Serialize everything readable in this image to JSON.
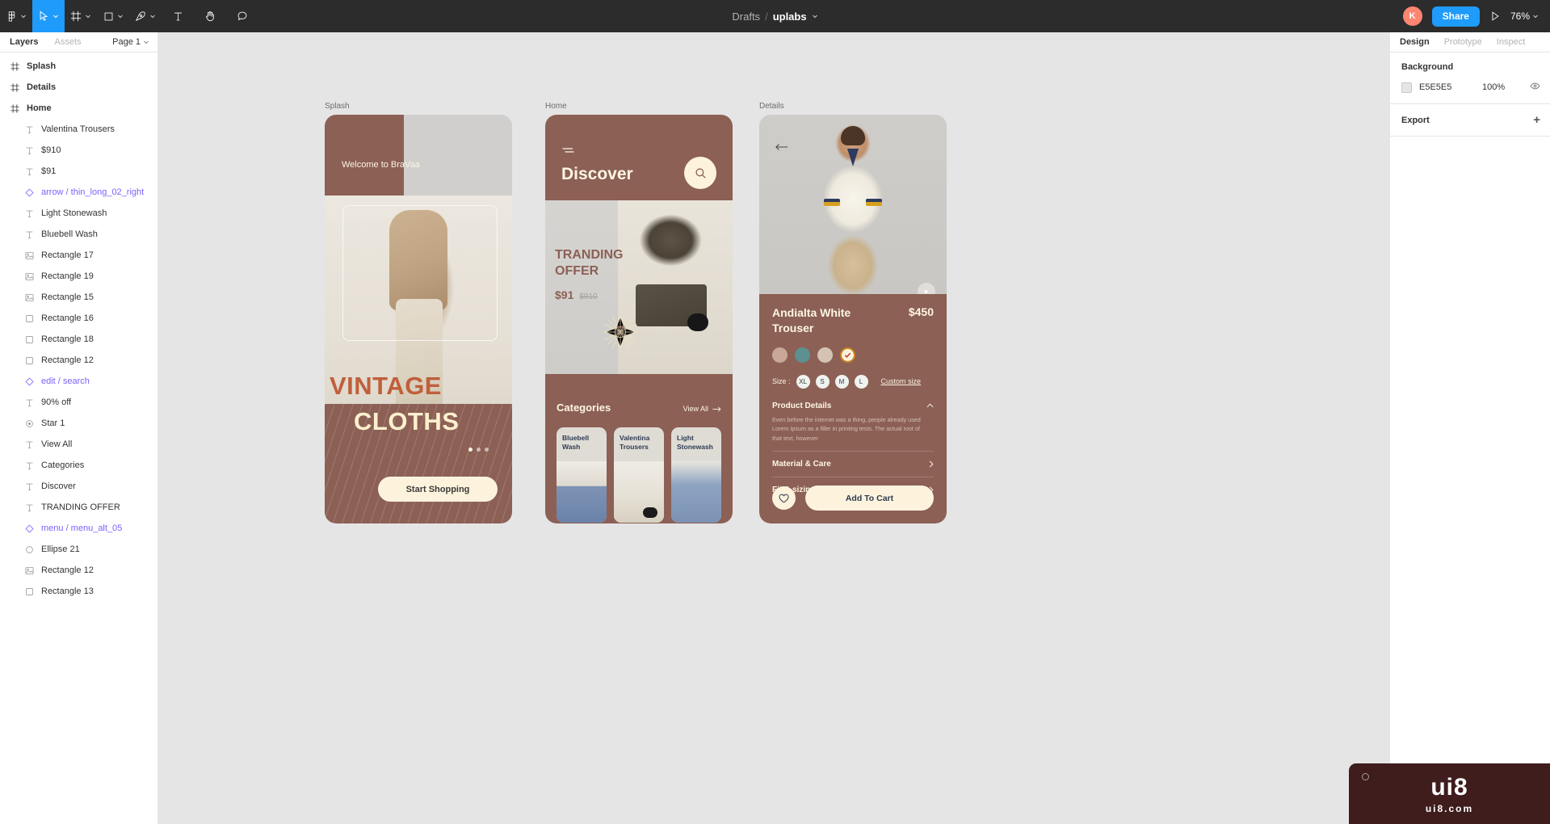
{
  "topbar": {
    "tools": [
      {
        "name": "figma-menu-icon",
        "caret": true
      },
      {
        "name": "move-tool-icon",
        "caret": true,
        "active": true
      },
      {
        "name": "frame-tool-icon",
        "caret": true
      },
      {
        "name": "shape-tool-icon",
        "caret": true
      },
      {
        "name": "pen-tool-icon",
        "caret": true
      },
      {
        "name": "text-tool-icon",
        "caret": false
      },
      {
        "name": "hand-tool-icon",
        "caret": false
      },
      {
        "name": "comment-tool-icon",
        "caret": false
      }
    ],
    "breadcrumb_root": "Drafts",
    "breadcrumb_sep": "/",
    "breadcrumb_file": "uplabs",
    "avatar_initial": "K",
    "share_label": "Share",
    "zoom_label": "76%"
  },
  "left_panel": {
    "tabs": [
      {
        "label": "Layers",
        "active": true
      },
      {
        "label": "Assets",
        "active": false
      }
    ],
    "page_label": "Page 1",
    "layers": [
      {
        "label": "Splash",
        "icon": "frame-icon",
        "depth": 0,
        "kind": "frame"
      },
      {
        "label": "Details",
        "icon": "frame-icon",
        "depth": 0,
        "kind": "frame"
      },
      {
        "label": "Home",
        "icon": "frame-icon",
        "depth": 0,
        "kind": "frame"
      },
      {
        "label": "Valentina Trousers",
        "icon": "text-icon",
        "depth": 1,
        "kind": "text"
      },
      {
        "label": "$910",
        "icon": "text-icon",
        "depth": 1,
        "kind": "text"
      },
      {
        "label": "$91",
        "icon": "text-icon",
        "depth": 1,
        "kind": "text"
      },
      {
        "label": "arrow / thin_long_02_right",
        "icon": "component-icon",
        "depth": 1,
        "kind": "component"
      },
      {
        "label": "Light Stonewash",
        "icon": "text-icon",
        "depth": 1,
        "kind": "text"
      },
      {
        "label": "Bluebell Wash",
        "icon": "text-icon",
        "depth": 1,
        "kind": "text"
      },
      {
        "label": "Rectangle 17",
        "icon": "image-icon",
        "depth": 1,
        "kind": "image"
      },
      {
        "label": "Rectangle 19",
        "icon": "image-icon",
        "depth": 1,
        "kind": "image"
      },
      {
        "label": "Rectangle 15",
        "icon": "image-icon",
        "depth": 1,
        "kind": "image"
      },
      {
        "label": "Rectangle 16",
        "icon": "rect-icon",
        "depth": 1,
        "kind": "rect"
      },
      {
        "label": "Rectangle 18",
        "icon": "rect-icon",
        "depth": 1,
        "kind": "rect"
      },
      {
        "label": "Rectangle 12",
        "icon": "rect-icon",
        "depth": 1,
        "kind": "rect"
      },
      {
        "label": "edit / search",
        "icon": "component-icon",
        "depth": 1,
        "kind": "component"
      },
      {
        "label": "90% off",
        "icon": "text-icon",
        "depth": 1,
        "kind": "text"
      },
      {
        "label": "Star 1",
        "icon": "star-icon",
        "depth": 1,
        "kind": "star"
      },
      {
        "label": "View All",
        "icon": "text-icon",
        "depth": 1,
        "kind": "text"
      },
      {
        "label": "Categories",
        "icon": "text-icon",
        "depth": 1,
        "kind": "text"
      },
      {
        "label": "Discover",
        "icon": "text-icon",
        "depth": 1,
        "kind": "text"
      },
      {
        "label": "TRANDING OFFER",
        "icon": "text-icon",
        "depth": 1,
        "kind": "text"
      },
      {
        "label": "menu / menu_alt_05",
        "icon": "component-icon",
        "depth": 1,
        "kind": "component"
      },
      {
        "label": "Ellipse 21",
        "icon": "ellipse-icon",
        "depth": 1,
        "kind": "ellipse"
      },
      {
        "label": "Rectangle 12",
        "icon": "image-icon",
        "depth": 1,
        "kind": "image"
      },
      {
        "label": "Rectangle 13",
        "icon": "rect-icon",
        "depth": 1,
        "kind": "rect"
      }
    ]
  },
  "right_panel": {
    "tabs": [
      {
        "label": "Design",
        "active": true
      },
      {
        "label": "Prototype",
        "active": false
      },
      {
        "label": "Inspect",
        "active": false
      }
    ],
    "background": {
      "title": "Background",
      "hex": "E5E5E5",
      "swatch_color": "#E5E5E5",
      "opacity": "100%",
      "visibility_icon": "eye-icon"
    },
    "export": {
      "title": "Export",
      "add_icon": "plus-icon"
    }
  },
  "canvas": {
    "frames": [
      {
        "label": "Splash"
      },
      {
        "label": "Home"
      },
      {
        "label": "Details"
      }
    ],
    "splash": {
      "welcome": "Welcome to BraVaa",
      "headline_top": "VINTAGE",
      "headline_bottom": "CLOTHS",
      "cta_label": "Start Shopping",
      "dots": 3,
      "active_dot": 0
    },
    "home": {
      "menu_icon": "menu-icon",
      "title": "Discover",
      "search_icon": "search-icon",
      "offer_line1": "TRANDING",
      "offer_line2": "OFFER",
      "price_current": "$91",
      "price_original": "$910",
      "badge_percent": "90%",
      "badge_off": "off",
      "categories_title": "Categories",
      "view_all_label": "View All",
      "view_all_icon": "arrow-right-icon",
      "categories": [
        {
          "label": "Bluebell Wash"
        },
        {
          "label": "Valentina Trousers"
        },
        {
          "label": "Light Stonewash"
        }
      ]
    },
    "details": {
      "back_icon": "arrow-left-icon",
      "play_icon": "play-icon",
      "product_name": "Andialta White Trouser",
      "price": "$450",
      "colors": [
        "#c9a898",
        "#5d9090",
        "#d4c3b2",
        "#fdf3dd"
      ],
      "selected_color_index": 3,
      "check_icon": "check-icon",
      "size_label": "Size :",
      "sizes": [
        "XL",
        "S",
        "M",
        "L"
      ],
      "custom_size_label": "Custom size",
      "accordion": [
        {
          "title": "Product Details",
          "icon": "chevron-up-icon",
          "body": "Even before the internet was a thing, people already used Lorem Ipsum as a filler in printing tests. The actual root of that text, however"
        },
        {
          "title": "Material & Care",
          "icon": "chevron-right-icon",
          "body": ""
        },
        {
          "title": "Fit & sizing",
          "icon": "chevron-right-icon",
          "body": ""
        }
      ],
      "favorite_icon": "heart-icon",
      "cart_label": "Add To Cart"
    }
  },
  "watermark": {
    "main": "ui8",
    "sub": "ui8.com",
    "dot_icon": "circle-icon"
  }
}
